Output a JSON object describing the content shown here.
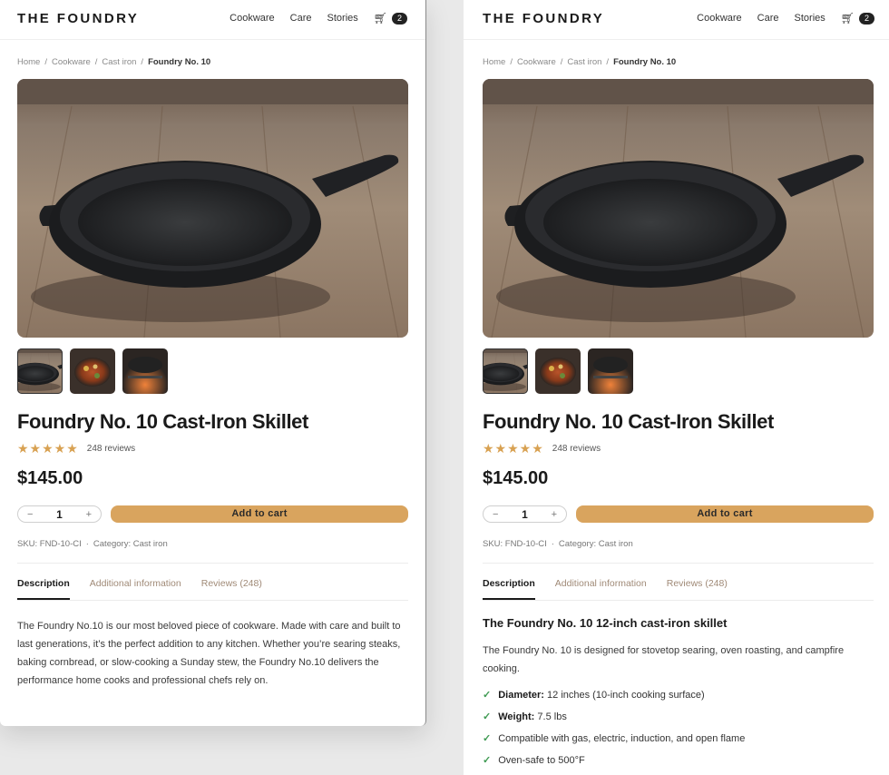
{
  "brand": "THE FOUNDRY",
  "nav": [
    "Cookware",
    "Care",
    "Stories"
  ],
  "cart_count": "2",
  "breadcrumb": {
    "items": [
      "Home",
      "Cookware",
      "Cast iron"
    ],
    "current": "Foundry No. 10",
    "separator": "/"
  },
  "product": {
    "title": "Foundry No. 10 Cast-Iron Skillet",
    "stars": "★★★★★",
    "rating_value": 5,
    "reviews": "248 reviews",
    "price": "$145.00",
    "quantity": "1",
    "minus": "−",
    "plus": "+",
    "add_to_cart": "Add to cart",
    "sku": "SKU: FND-10-CI",
    "category": "Category: Cast iron",
    "meta_separator": "·"
  },
  "tabs": [
    "Description",
    "Additional information",
    "Reviews (248)"
  ],
  "active_tab": "Description",
  "left_description": "The Foundry No.10 is our most beloved piece of cookware. Made with care and built to last generations, it’s the perfect addition to any kitchen. Whether you’re searing steaks, baking cornbread, or slow-cooking a Sunday stew, the Foundry No.10 delivers the performance home cooks and professional chefs rely on.",
  "right_description": {
    "heading": "The Foundry No. 10 12-inch cast-iron skillet",
    "intro": "The Foundry No. 10 is designed for stovetop searing, oven roasting, and campfire cooking.",
    "specs": [
      {
        "label": "Diameter:",
        "value": "12 inches (10-inch cooking surface)"
      },
      {
        "label": "Weight:",
        "value": "7.5 lbs"
      },
      {
        "label": "",
        "value": "Compatible with gas, electric, induction, and open flame"
      },
      {
        "label": "",
        "value": "Oven-safe to 500°F"
      }
    ]
  },
  "icons": {
    "cart": "cart-icon",
    "check": "check-icon",
    "star": "star-icon"
  },
  "colors": {
    "accent": "#d9a45e",
    "star": "#d8a152",
    "check": "#3e9a52",
    "tab_inactive": "#a08a77"
  }
}
